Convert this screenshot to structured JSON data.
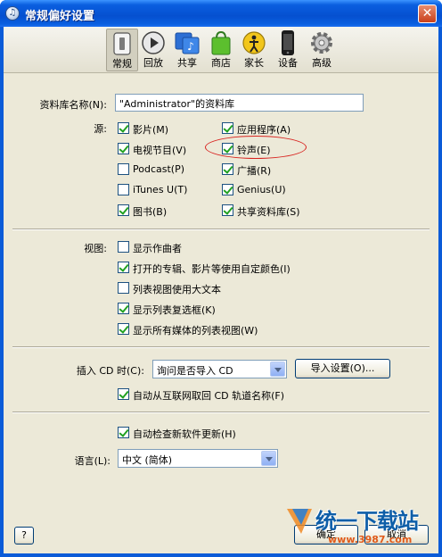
{
  "window": {
    "title": "常规偏好设置",
    "close_glyph": "✕"
  },
  "toolbar": {
    "items": [
      {
        "label": "常规",
        "icon": "general-switch-icon",
        "selected": true
      },
      {
        "label": "回放",
        "icon": "playback-icon",
        "selected": false
      },
      {
        "label": "共享",
        "icon": "sharing-icon",
        "selected": false
      },
      {
        "label": "商店",
        "icon": "store-bag-icon",
        "selected": false
      },
      {
        "label": "家长",
        "icon": "parental-icon",
        "selected": false
      },
      {
        "label": "设备",
        "icon": "device-iphone-icon",
        "selected": false
      },
      {
        "label": "高级",
        "icon": "gear-icon",
        "selected": false
      }
    ]
  },
  "library": {
    "name_label": "资料库名称(N):",
    "name_value": "\"Administrator\"的资料库"
  },
  "sources": {
    "label": "源:",
    "items": [
      {
        "label": "影片(M)",
        "checked": true
      },
      {
        "label": "应用程序(A)",
        "checked": true
      },
      {
        "label": "电视节目(V)",
        "checked": true
      },
      {
        "label": "铃声(E)",
        "checked": true
      },
      {
        "label": "Podcast(P)",
        "checked": false
      },
      {
        "label": "广播(R)",
        "checked": true
      },
      {
        "label": "iTunes U(T)",
        "checked": false
      },
      {
        "label": "Genius(U)",
        "checked": true
      },
      {
        "label": "图书(B)",
        "checked": true
      },
      {
        "label": "共享资料库(S)",
        "checked": true
      }
    ]
  },
  "views": {
    "label": "视图:",
    "items": [
      {
        "label": "显示作曲者",
        "checked": false
      },
      {
        "label": "打开的专辑、影片等使用自定颜色(I)",
        "checked": true
      },
      {
        "label": "列表视图使用大文本",
        "checked": false
      },
      {
        "label": "显示列表复选框(K)",
        "checked": true
      },
      {
        "label": "显示所有媒体的列表视图(W)",
        "checked": true
      }
    ]
  },
  "cd": {
    "label": "插入 CD 时(C):",
    "value": "询问是否导入 CD",
    "import_settings_label": "导入设置(O)...",
    "auto_names_label": "自动从互联网取回 CD 轨道名称(F)",
    "auto_names_checked": true
  },
  "updates": {
    "label": "自动检查新软件更新(H)",
    "checked": true
  },
  "language": {
    "label": "语言(L):",
    "value": "中文 (简体)"
  },
  "footer": {
    "help_label": "?",
    "ok_label": "确定",
    "cancel_label": "取消"
  },
  "watermark": {
    "brand": "统一下载站",
    "url": "www.3987.com"
  },
  "colors": {
    "titlebar": "#0a5bd8",
    "panel": "#ece9d8",
    "annotation": "#d8231f",
    "check": "#21a121"
  }
}
